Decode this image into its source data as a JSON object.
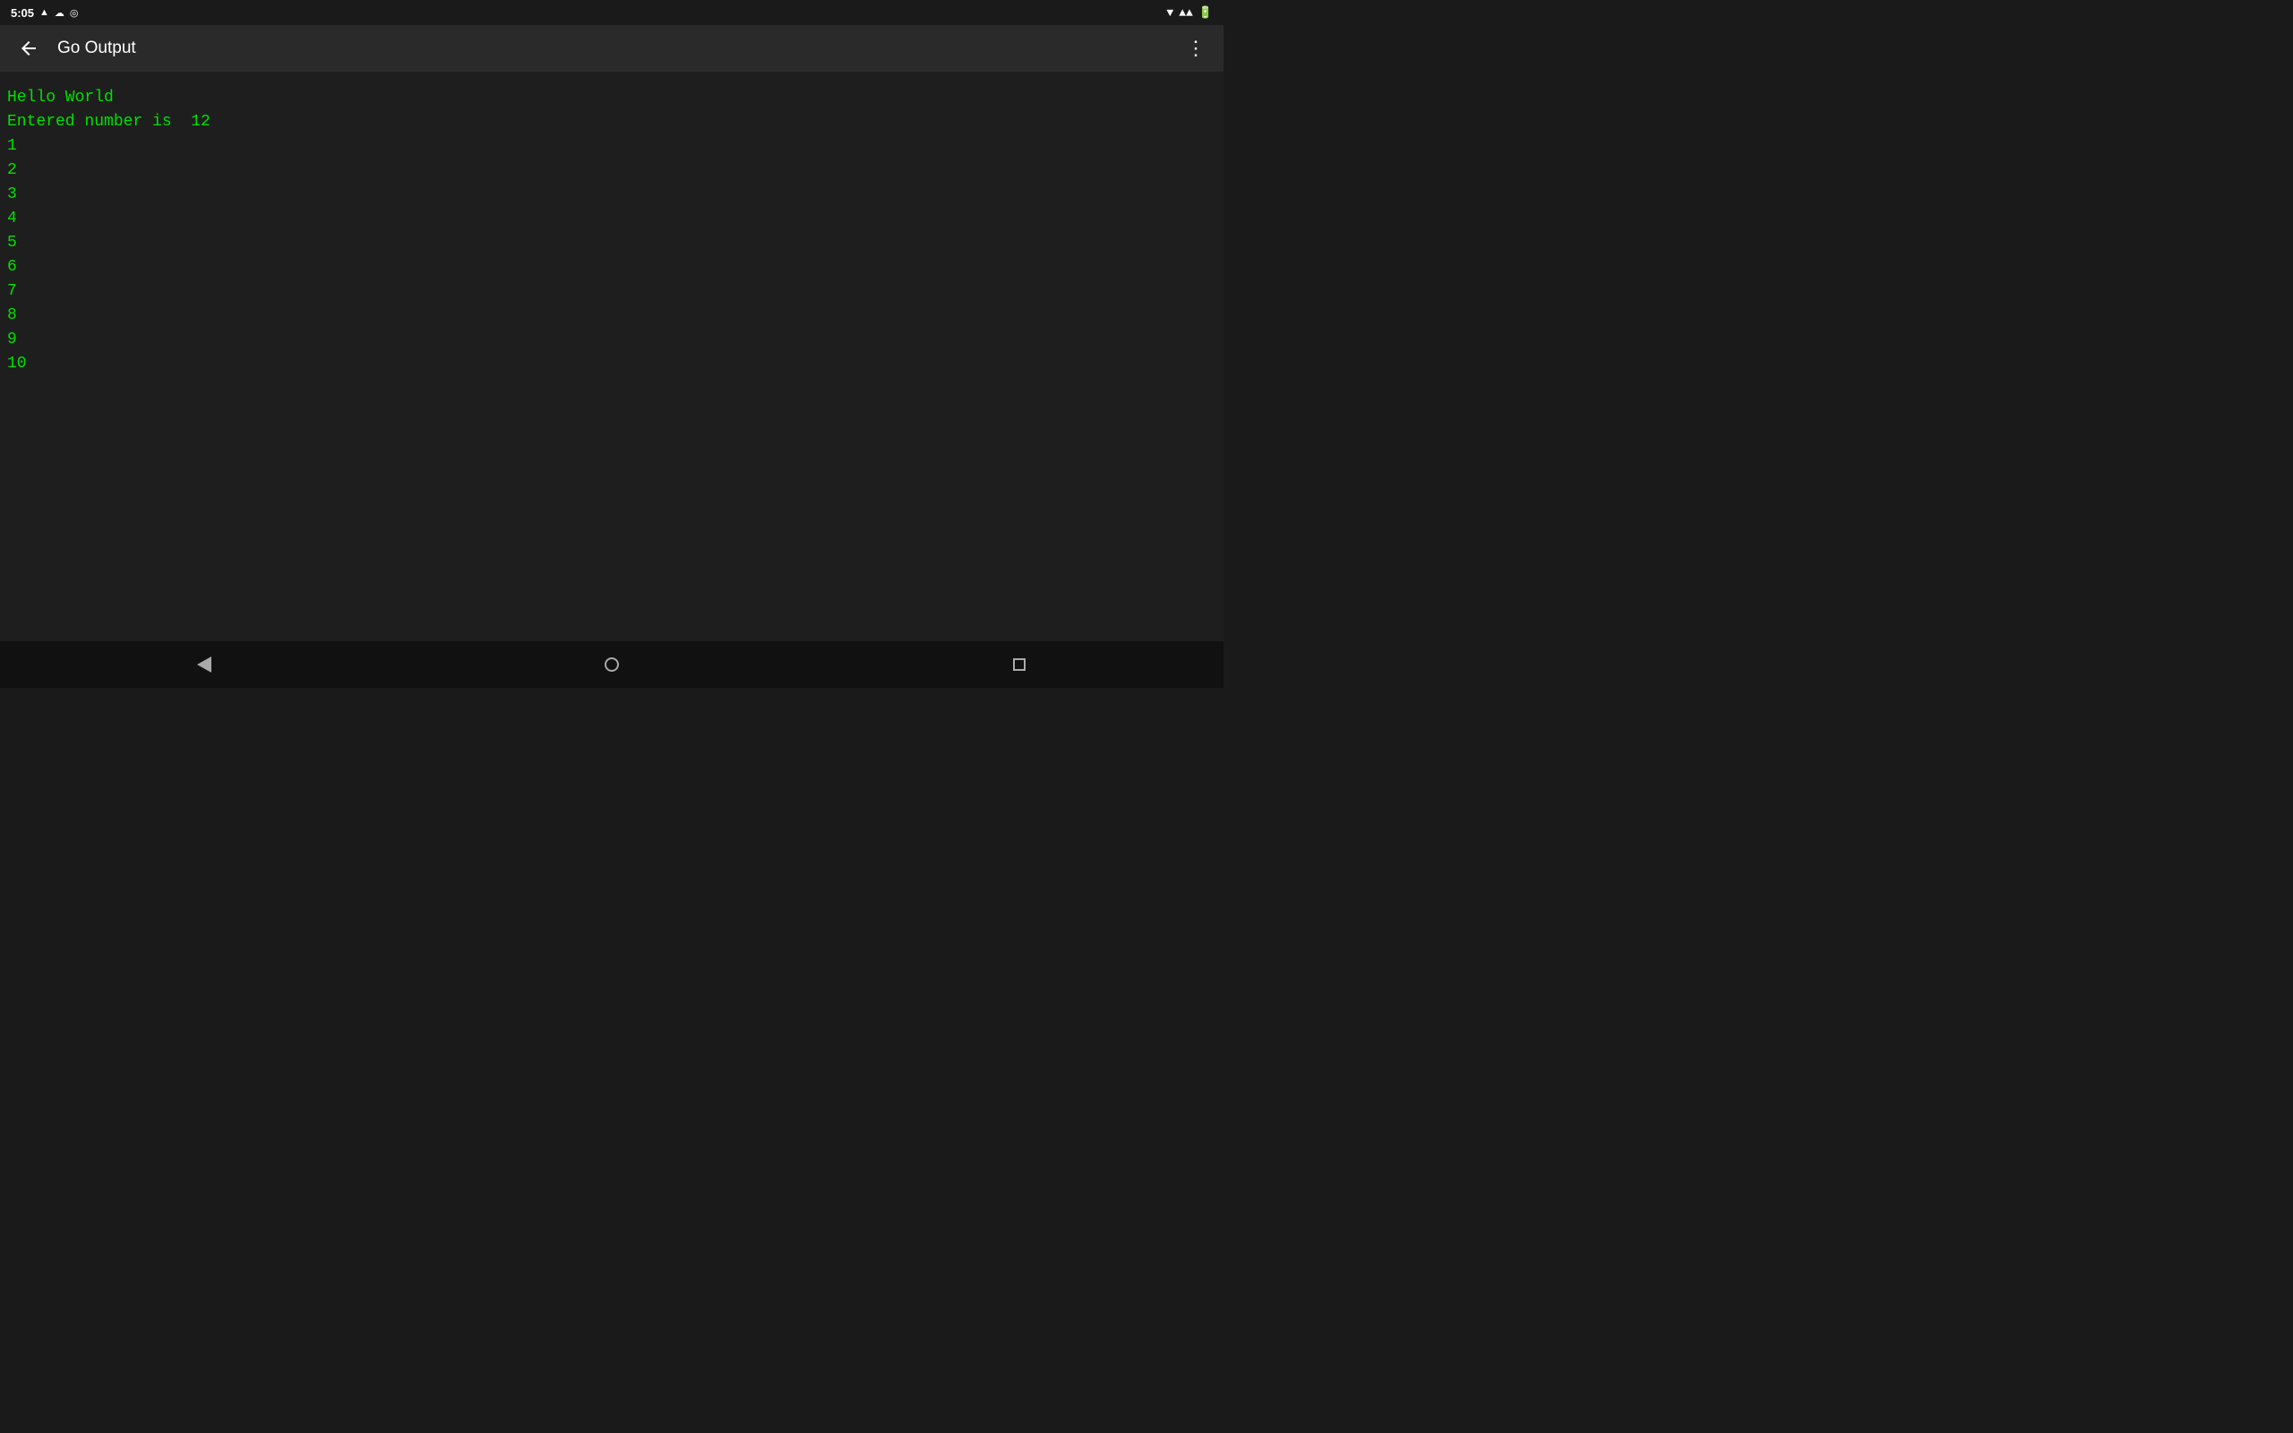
{
  "statusBar": {
    "time": "5:05",
    "icons": [
      "A",
      "☁",
      "◎"
    ]
  },
  "appBar": {
    "title": "Go Output",
    "backLabel": "‹",
    "overflowLabel": "⋮"
  },
  "output": {
    "lines": [
      "Hello World",
      "Entered number is  12",
      "1",
      "2",
      "3",
      "4",
      "5",
      "6",
      "7",
      "8",
      "9",
      "10"
    ]
  },
  "navBar": {
    "back": "back",
    "home": "home",
    "recents": "recents"
  }
}
